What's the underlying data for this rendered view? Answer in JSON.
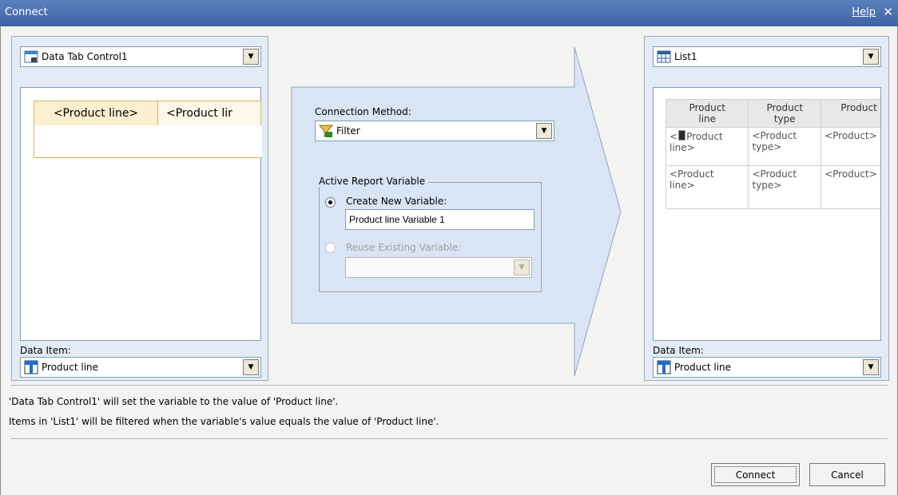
{
  "window": {
    "title": "Connect",
    "help_label": "Help",
    "close_glyph": "✕"
  },
  "source": {
    "control_select": {
      "value": "Data Tab Control1",
      "icon": "tab-control-icon"
    },
    "tabs": [
      "<Product line>",
      "<Product lir"
    ],
    "data_item_label": "Data Item:",
    "data_item_select": {
      "value": "Product line",
      "icon": "data-item-icon"
    }
  },
  "connection": {
    "method_label": "Connection Method:",
    "method_select": {
      "value": "Filter",
      "icon": "filter-icon"
    },
    "group_title": "Active Report Variable",
    "create_new_label": "Create New Variable:",
    "create_new_value": "Product line Variable 1",
    "reuse_label": "Reuse Existing Variable:",
    "reuse_value": ""
  },
  "target": {
    "control_select": {
      "value": "List1",
      "icon": "list-icon"
    },
    "table": {
      "columns": [
        [
          "Product",
          "line"
        ],
        [
          "Product",
          "type"
        ],
        [
          "Product",
          ""
        ]
      ],
      "rows": [
        [
          [
            "<",
            "Product",
            "line>"
          ],
          [
            "<Product",
            "type>"
          ],
          [
            "<Product>",
            ""
          ]
        ],
        [
          [
            "<Product",
            "line>"
          ],
          [
            "<Product",
            "type>"
          ],
          [
            "<Product>",
            ""
          ]
        ]
      ]
    },
    "data_item_label": "Data Item:",
    "data_item_select": {
      "value": "Product line",
      "icon": "data-item-icon"
    }
  },
  "messages": [
    "'Data Tab Control1' will set the variable to the value of 'Product line'.",
    "Items in 'List1' will be filtered when the variable's value equals the value of 'Product line'."
  ],
  "buttons": {
    "connect": "Connect",
    "cancel": "Cancel"
  },
  "colors": {
    "titlebar": "#4a6fb0",
    "panel": "#e3ebf6",
    "arrow_fill": "#d9e5f5",
    "tab_border": "#d9b35a"
  }
}
